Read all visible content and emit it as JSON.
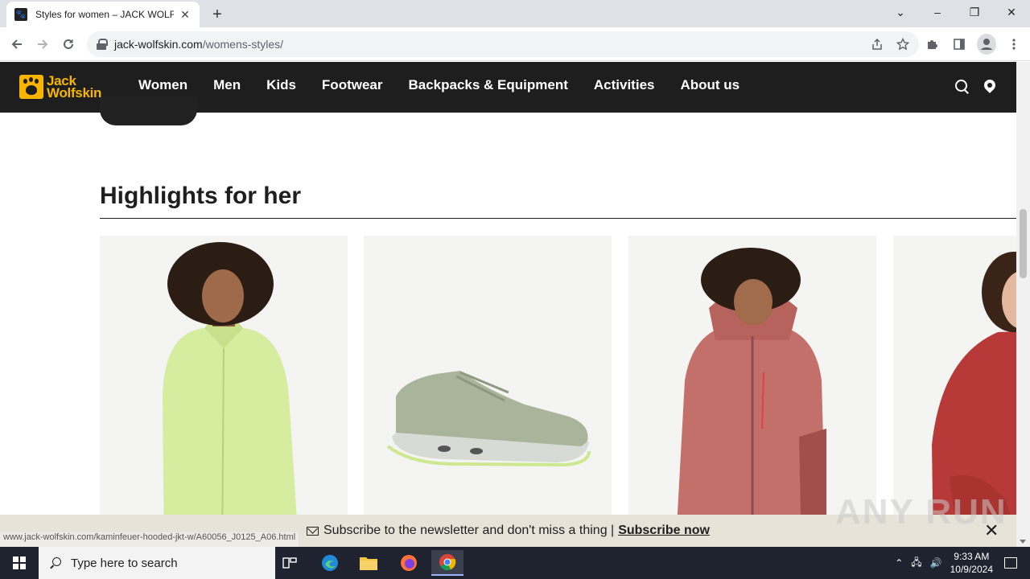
{
  "browser": {
    "tab_title": "Styles for women – JACK WOLFS",
    "tab_close": "✕",
    "new_tab": "+",
    "url_domain": "jack-wolfskin.com",
    "url_path": "/womens-styles/",
    "window_controls": [
      "⌄",
      "–",
      "❐",
      "✕"
    ]
  },
  "site": {
    "logo_line1": "Jack",
    "logo_line2": "Wolfskin",
    "nav": [
      "Women",
      "Men",
      "Kids",
      "Footwear",
      "Backpacks & Equipment",
      "Activities",
      "About us"
    ]
  },
  "section": {
    "title": "Highlights for her"
  },
  "products": [
    {
      "image": "woman-lime-fleece-jacket",
      "colors": {
        "bg": "#f4f4f2",
        "garment": "#d6ec9f"
      }
    },
    {
      "image": "sage-hiking-shoe",
      "colors": {
        "bg": "#f4f4f2",
        "garment": "#a9b59a"
      }
    },
    {
      "image": "woman-pink-rain-jacket",
      "colors": {
        "bg": "#f4f4f2",
        "garment": "#c4706a"
      }
    },
    {
      "image": "woman-red-fleece-jacket",
      "colors": {
        "bg": "#f4f4f2",
        "garment": "#b83a38"
      }
    }
  ],
  "newsletter": {
    "text": "Subscribe to the newsletter and don't miss a thing |",
    "link": "Subscribe now",
    "close": "✕"
  },
  "status_url": "www.jack-wolfskin.com/kaminfeuer-hooded-jkt-w/A60056_J0125_A06.html",
  "watermark": "ANY RUN",
  "taskbar": {
    "search_placeholder": "Type here to search",
    "time": "9:33 AM",
    "date": "10/9/2024"
  },
  "colors": {
    "brand_yellow": "#f7b500",
    "header_bg": "#1e1e1e",
    "newsletter_bg": "#e7e3d8"
  }
}
